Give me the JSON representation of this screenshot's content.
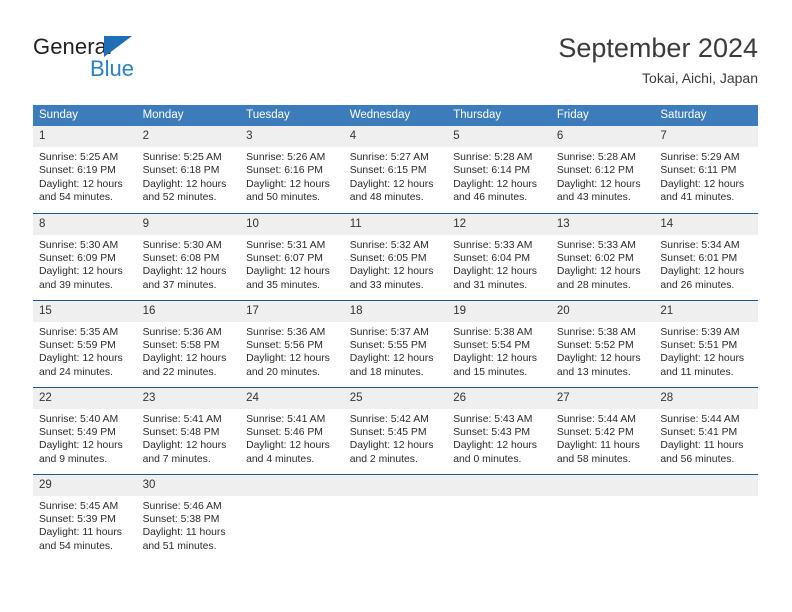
{
  "brand": {
    "name_top": "General",
    "name_bottom": "Blue",
    "triangle_color": "#1f6eb5",
    "text_color": "#231f20",
    "blue_color": "#2a7fc9"
  },
  "header": {
    "title": "September 2024",
    "subtitle": "Tokai, Aichi, Japan"
  },
  "theme": {
    "header_band": "#3d7cba",
    "week_separator": "#1f5c96",
    "daynum_band": "#efefef",
    "page_background": "#ffffff"
  },
  "calendar": {
    "weekday_headers": [
      "Sunday",
      "Monday",
      "Tuesday",
      "Wednesday",
      "Thursday",
      "Friday",
      "Saturday"
    ],
    "weeks": [
      [
        {
          "day": "1",
          "lines": [
            "Sunrise: 5:25 AM",
            "Sunset: 6:19 PM",
            "Daylight: 12 hours",
            "and 54 minutes."
          ]
        },
        {
          "day": "2",
          "lines": [
            "Sunrise: 5:25 AM",
            "Sunset: 6:18 PM",
            "Daylight: 12 hours",
            "and 52 minutes."
          ]
        },
        {
          "day": "3",
          "lines": [
            "Sunrise: 5:26 AM",
            "Sunset: 6:16 PM",
            "Daylight: 12 hours",
            "and 50 minutes."
          ]
        },
        {
          "day": "4",
          "lines": [
            "Sunrise: 5:27 AM",
            "Sunset: 6:15 PM",
            "Daylight: 12 hours",
            "and 48 minutes."
          ]
        },
        {
          "day": "5",
          "lines": [
            "Sunrise: 5:28 AM",
            "Sunset: 6:14 PM",
            "Daylight: 12 hours",
            "and 46 minutes."
          ]
        },
        {
          "day": "6",
          "lines": [
            "Sunrise: 5:28 AM",
            "Sunset: 6:12 PM",
            "Daylight: 12 hours",
            "and 43 minutes."
          ]
        },
        {
          "day": "7",
          "lines": [
            "Sunrise: 5:29 AM",
            "Sunset: 6:11 PM",
            "Daylight: 12 hours",
            "and 41 minutes."
          ]
        }
      ],
      [
        {
          "day": "8",
          "lines": [
            "Sunrise: 5:30 AM",
            "Sunset: 6:09 PM",
            "Daylight: 12 hours",
            "and 39 minutes."
          ]
        },
        {
          "day": "9",
          "lines": [
            "Sunrise: 5:30 AM",
            "Sunset: 6:08 PM",
            "Daylight: 12 hours",
            "and 37 minutes."
          ]
        },
        {
          "day": "10",
          "lines": [
            "Sunrise: 5:31 AM",
            "Sunset: 6:07 PM",
            "Daylight: 12 hours",
            "and 35 minutes."
          ]
        },
        {
          "day": "11",
          "lines": [
            "Sunrise: 5:32 AM",
            "Sunset: 6:05 PM",
            "Daylight: 12 hours",
            "and 33 minutes."
          ]
        },
        {
          "day": "12",
          "lines": [
            "Sunrise: 5:33 AM",
            "Sunset: 6:04 PM",
            "Daylight: 12 hours",
            "and 31 minutes."
          ]
        },
        {
          "day": "13",
          "lines": [
            "Sunrise: 5:33 AM",
            "Sunset: 6:02 PM",
            "Daylight: 12 hours",
            "and 28 minutes."
          ]
        },
        {
          "day": "14",
          "lines": [
            "Sunrise: 5:34 AM",
            "Sunset: 6:01 PM",
            "Daylight: 12 hours",
            "and 26 minutes."
          ]
        }
      ],
      [
        {
          "day": "15",
          "lines": [
            "Sunrise: 5:35 AM",
            "Sunset: 5:59 PM",
            "Daylight: 12 hours",
            "and 24 minutes."
          ]
        },
        {
          "day": "16",
          "lines": [
            "Sunrise: 5:36 AM",
            "Sunset: 5:58 PM",
            "Daylight: 12 hours",
            "and 22 minutes."
          ]
        },
        {
          "day": "17",
          "lines": [
            "Sunrise: 5:36 AM",
            "Sunset: 5:56 PM",
            "Daylight: 12 hours",
            "and 20 minutes."
          ]
        },
        {
          "day": "18",
          "lines": [
            "Sunrise: 5:37 AM",
            "Sunset: 5:55 PM",
            "Daylight: 12 hours",
            "and 18 minutes."
          ]
        },
        {
          "day": "19",
          "lines": [
            "Sunrise: 5:38 AM",
            "Sunset: 5:54 PM",
            "Daylight: 12 hours",
            "and 15 minutes."
          ]
        },
        {
          "day": "20",
          "lines": [
            "Sunrise: 5:38 AM",
            "Sunset: 5:52 PM",
            "Daylight: 12 hours",
            "and 13 minutes."
          ]
        },
        {
          "day": "21",
          "lines": [
            "Sunrise: 5:39 AM",
            "Sunset: 5:51 PM",
            "Daylight: 12 hours",
            "and 11 minutes."
          ]
        }
      ],
      [
        {
          "day": "22",
          "lines": [
            "Sunrise: 5:40 AM",
            "Sunset: 5:49 PM",
            "Daylight: 12 hours",
            "and 9 minutes."
          ]
        },
        {
          "day": "23",
          "lines": [
            "Sunrise: 5:41 AM",
            "Sunset: 5:48 PM",
            "Daylight: 12 hours",
            "and 7 minutes."
          ]
        },
        {
          "day": "24",
          "lines": [
            "Sunrise: 5:41 AM",
            "Sunset: 5:46 PM",
            "Daylight: 12 hours",
            "and 4 minutes."
          ]
        },
        {
          "day": "25",
          "lines": [
            "Sunrise: 5:42 AM",
            "Sunset: 5:45 PM",
            "Daylight: 12 hours",
            "and 2 minutes."
          ]
        },
        {
          "day": "26",
          "lines": [
            "Sunrise: 5:43 AM",
            "Sunset: 5:43 PM",
            "Daylight: 12 hours",
            "and 0 minutes."
          ]
        },
        {
          "day": "27",
          "lines": [
            "Sunrise: 5:44 AM",
            "Sunset: 5:42 PM",
            "Daylight: 11 hours",
            "and 58 minutes."
          ]
        },
        {
          "day": "28",
          "lines": [
            "Sunrise: 5:44 AM",
            "Sunset: 5:41 PM",
            "Daylight: 11 hours",
            "and 56 minutes."
          ]
        }
      ],
      [
        {
          "day": "29",
          "lines": [
            "Sunrise: 5:45 AM",
            "Sunset: 5:39 PM",
            "Daylight: 11 hours",
            "and 54 minutes."
          ]
        },
        {
          "day": "30",
          "lines": [
            "Sunrise: 5:46 AM",
            "Sunset: 5:38 PM",
            "Daylight: 11 hours",
            "and 51 minutes."
          ]
        },
        {
          "day": "",
          "lines": []
        },
        {
          "day": "",
          "lines": []
        },
        {
          "day": "",
          "lines": []
        },
        {
          "day": "",
          "lines": []
        },
        {
          "day": "",
          "lines": []
        }
      ]
    ]
  }
}
